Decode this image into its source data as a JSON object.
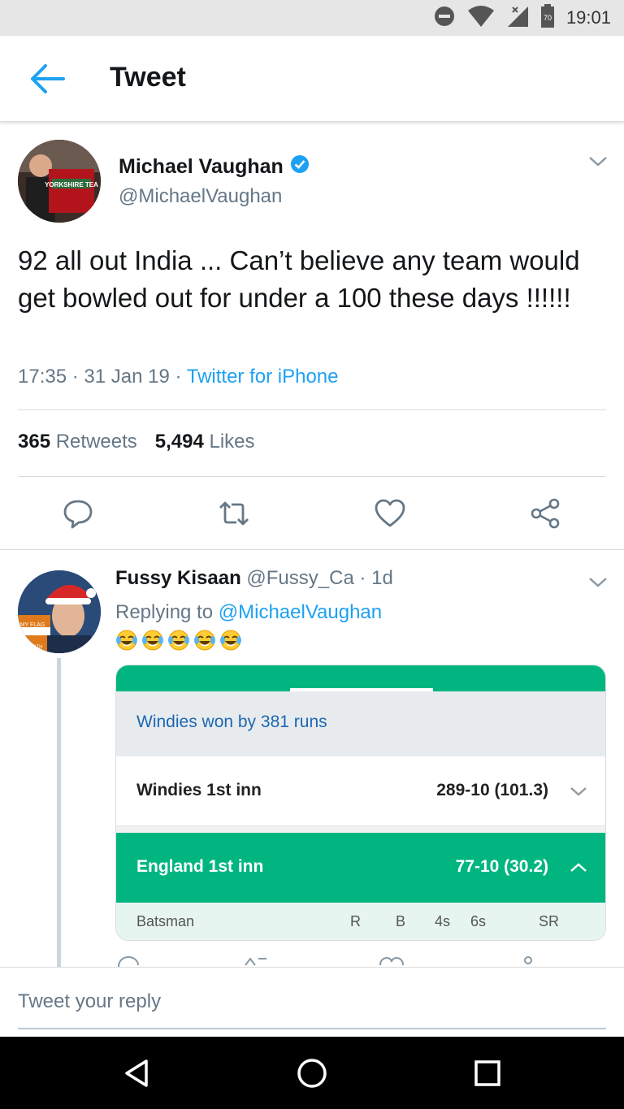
{
  "status_bar": {
    "time": "19:01",
    "battery_level": "70",
    "icons": [
      "dnd-icon",
      "wifi-icon",
      "signal-icon",
      "battery-icon"
    ]
  },
  "app_bar": {
    "title": "Tweet",
    "back_icon": "arrow-left-icon"
  },
  "tweet": {
    "author_name": "Michael Vaughan",
    "author_handle": "@MichaelVaughan",
    "verified": true,
    "avatar_text": "YORKSHIRE TEA",
    "text": "92 all out India ... Can’t believe any team would get bowled out for under a 100 these days !!!!!!",
    "time": "17:35",
    "date": "31 Jan 19",
    "source": "Twitter for iPhone",
    "retweets_count": "365",
    "retweets_label": "Retweets",
    "likes_count": "5,494",
    "likes_label": "Likes",
    "actions": [
      "reply-icon",
      "retweet-icon",
      "like-icon",
      "share-icon"
    ]
  },
  "reply": {
    "author_name": "Fussy Kisaan",
    "author_handle": "@Fussy_Ca",
    "age": "1d",
    "replying_label": "Replying to",
    "replying_to": "@MichaelVaughan",
    "emoji_count": 5,
    "avatar_text_1": "MY FLAG",
    "avatar_text_2": "FAITH",
    "scorecard": {
      "result": "Windies won by 381 runs",
      "inn1_label": "Windies 1st inn",
      "inn1_score": "289-10 (101.3)",
      "inn2_label": "England 1st inn",
      "inn2_score": "77-10 (30.2)",
      "cols": [
        "Batsman",
        "R",
        "B",
        "4s",
        "6s",
        "SR"
      ]
    }
  },
  "composer": {
    "placeholder": "Tweet your reply"
  },
  "colors": {
    "twitter_blue": "#1da1f2",
    "secondary_text": "#657786",
    "scorecard_green": "#00b580"
  }
}
